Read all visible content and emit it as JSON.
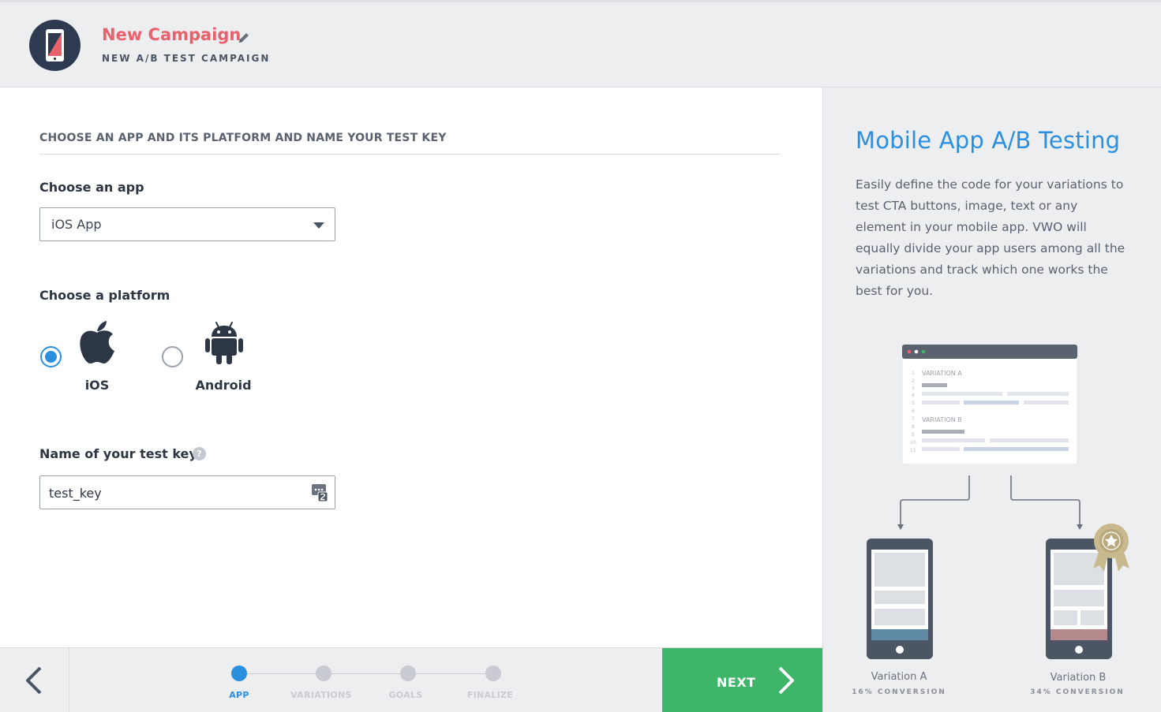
{
  "header": {
    "campaign_title": "New Campaign",
    "campaign_subtitle": "NEW A/B TEST CAMPAIGN"
  },
  "form": {
    "section_title": "CHOOSE AN APP AND ITS PLATFORM AND NAME YOUR TEST KEY",
    "app": {
      "label": "Choose an app",
      "selected": "iOS App"
    },
    "platform": {
      "label": "Choose a platform",
      "options": [
        {
          "label": "iOS",
          "icon": "apple-icon",
          "checked": true
        },
        {
          "label": "Android",
          "icon": "android-icon",
          "checked": false
        }
      ]
    },
    "test_key": {
      "label": "Name of your test key",
      "help": "?",
      "value": "test_key"
    }
  },
  "footer": {
    "steps": [
      {
        "label": "APP",
        "active": true
      },
      {
        "label": "VARIATIONS",
        "active": false
      },
      {
        "label": "GOALS",
        "active": false
      },
      {
        "label": "FINALIZE",
        "active": false
      }
    ],
    "next_label": "NEXT"
  },
  "side_panel": {
    "title": "Mobile App A/B Testing",
    "description": "Easily define the code for your variations to test CTA buttons, image, text or any element in your mobile app. VWO will equally divide your app users among all the variations and track which one works the best for you.",
    "illustration": {
      "variation_a_code_label": "VARIATION A",
      "variation_b_code_label": "VARIATION B",
      "line_numbers": [
        "1",
        "2",
        "3",
        "4",
        "5",
        "6",
        "7",
        "8",
        "9",
        "10",
        "11"
      ],
      "variation_a": {
        "name": "Variation A",
        "conversion": "16% CONVERSION"
      },
      "variation_b": {
        "name": "Variation B",
        "conversion": "34% CONVERSION"
      }
    }
  },
  "colors": {
    "accent_blue": "#2b8fe0",
    "campaign_red": "#e8616b",
    "next_green": "#3fb56a",
    "header_bg": "#eceef0"
  }
}
